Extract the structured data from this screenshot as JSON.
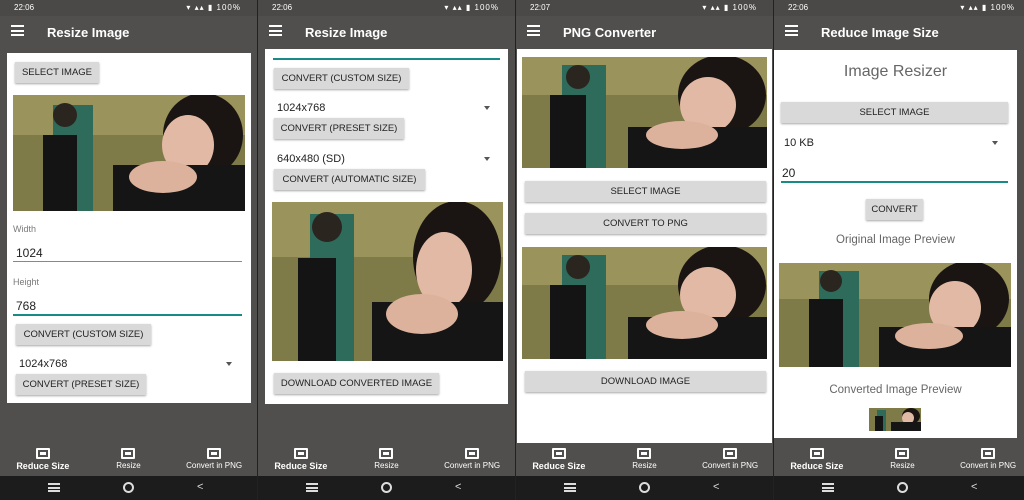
{
  "status": {
    "time1": "22:06",
    "time2": "22:06",
    "time3": "22:07",
    "time4": "22:06",
    "battery": "100%"
  },
  "colors": {
    "bar": "#514f4d",
    "accent": "#1a8a86",
    "button": "#d9d9d9"
  },
  "screen1": {
    "title": "Resize Image",
    "select_image": "SELECT IMAGE",
    "width_label": "Width",
    "width_value": "1024",
    "height_label": "Height",
    "height_value": "768",
    "convert_custom": "CONVERT (CUSTOM SIZE)",
    "preset_value": "1024x768",
    "convert_preset": "CONVERT (PRESET SIZE)"
  },
  "screen2": {
    "title": "Resize Image",
    "convert_custom": "CONVERT (CUSTOM SIZE)",
    "preset_value": "1024x768",
    "convert_preset": "CONVERT (PRESET SIZE)",
    "auto_value": "640x480 (SD)",
    "convert_auto": "CONVERT (AUTOMATIC SIZE)",
    "download": "DOWNLOAD CONVERTED IMAGE"
  },
  "screen3": {
    "title": "PNG Converter",
    "select_image": "SELECT IMAGE",
    "convert_png": "CONVERT TO PNG",
    "download": "DOWNLOAD IMAGE"
  },
  "screen4": {
    "title": "Reduce Image Size",
    "heading": "Image Resizer",
    "select_image": "SELECT IMAGE",
    "size_option": "10 KB",
    "quality_value": "20",
    "convert": "CONVERT",
    "original_preview": "Original Image Preview",
    "converted_preview": "Converted Image Preview"
  },
  "nav": {
    "reduce": "Reduce Size",
    "resize": "Resize",
    "png": "Convert in PNG"
  },
  "icons": [
    "menu-icon",
    "wifi-icon",
    "signal-icon",
    "battery-icon",
    "reduce-size-icon",
    "resize-icon",
    "convert-png-icon",
    "system-recents-icon",
    "system-home-icon",
    "system-back-icon",
    "dropdown-caret-icon"
  ]
}
